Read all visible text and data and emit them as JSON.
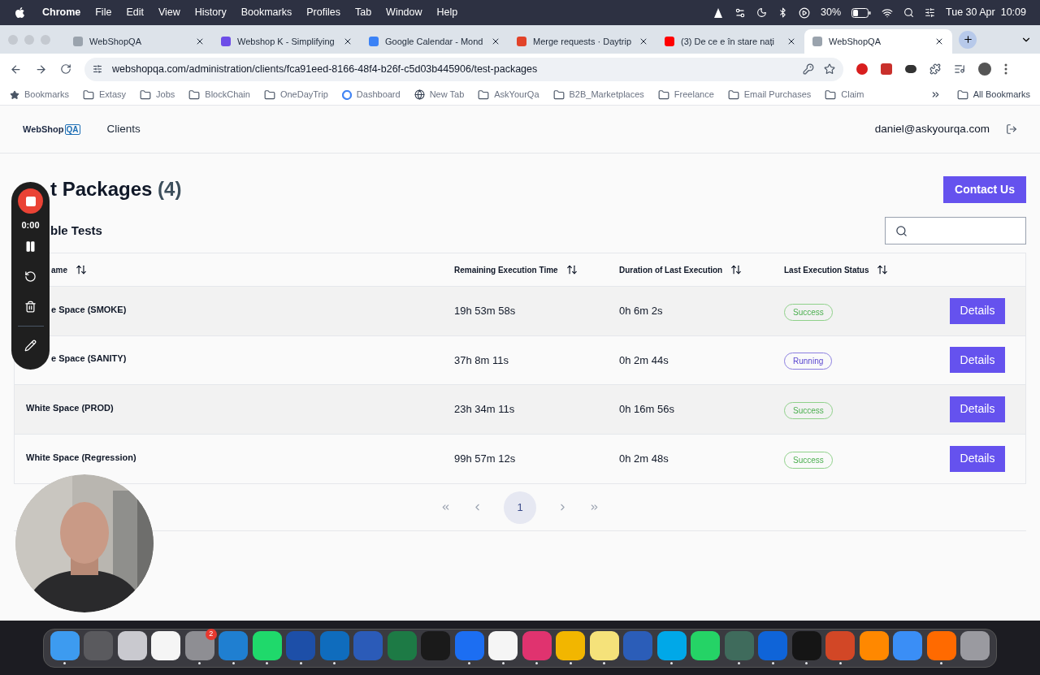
{
  "menu_bar": {
    "app": "Chrome",
    "items": [
      "File",
      "Edit",
      "View",
      "History",
      "Bookmarks",
      "Profiles",
      "Tab",
      "Window",
      "Help"
    ],
    "battery": "30%",
    "date": "Tue 30 Apr",
    "time": "10:09"
  },
  "tabs": [
    {
      "title": "WebShopQA",
      "selected": false,
      "color": "#9aa3ad"
    },
    {
      "title": "Webshop K - Simplifying",
      "selected": false,
      "color": "#6d4de8"
    },
    {
      "title": "Google Calendar - Mond",
      "selected": false,
      "color": "#3b82f6"
    },
    {
      "title": "Merge requests · Daytrip",
      "selected": false,
      "color": "#e24329"
    },
    {
      "title": "(3) De ce e în stare nați",
      "selected": false,
      "color": "#ff0000"
    },
    {
      "title": "WebShopQA",
      "selected": true,
      "color": "#9aa3ad"
    }
  ],
  "address": {
    "url": "webshopqa.com/administration/clients/fca91eed-8166-48f4-b26f-c5d03b445906/test-packages"
  },
  "bookmarks": [
    {
      "label": "Bookmarks",
      "kind": "star"
    },
    {
      "label": "Extasy",
      "kind": "folder"
    },
    {
      "label": "Jobs",
      "kind": "folder"
    },
    {
      "label": "BlockChain",
      "kind": "folder"
    },
    {
      "label": "OneDayTrip",
      "kind": "folder"
    },
    {
      "label": "Dashboard",
      "kind": "google"
    },
    {
      "label": "New Tab",
      "kind": "globe"
    },
    {
      "label": "AskYourQa",
      "kind": "folder"
    },
    {
      "label": "B2B_Marketplaces",
      "kind": "folder"
    },
    {
      "label": "Freelance",
      "kind": "folder"
    },
    {
      "label": "Email Purchases",
      "kind": "folder"
    },
    {
      "label": "Claim",
      "kind": "folder"
    }
  ],
  "all_bookmarks": "All Bookmarks",
  "header": {
    "logo": "WebShop",
    "logo_mark": "QA",
    "nav": "Clients",
    "user": "daniel@askyourqa.com"
  },
  "title": "t Packages",
  "count": "(4)",
  "contact_button": "Contact Us",
  "subtitle": "ble Tests",
  "table": {
    "columns": [
      "ame",
      "Remaining Execution Time",
      "Duration of Last Execution",
      "Last Execution Status"
    ],
    "rows": [
      {
        "name": "e Space (SMOKE)",
        "remaining": "19h 53m 58s",
        "duration": "0h 6m 2s",
        "status": {
          "label": "Success",
          "kind": "success"
        },
        "action": "Details"
      },
      {
        "name": "e Space (SANITY)",
        "remaining": "37h 8m 11s",
        "duration": "0h 2m 44s",
        "status": {
          "label": "Running",
          "kind": "running"
        },
        "action": "Details"
      },
      {
        "name": "White Space (PROD)",
        "remaining": "23h 34m 11s",
        "duration": "0h 16m 56s",
        "status": {
          "label": "Success",
          "kind": "success"
        },
        "action": "Details"
      },
      {
        "name": "White Space (Regression)",
        "remaining": "99h 57m 12s",
        "duration": "0h 2m 48s",
        "status": {
          "label": "Success",
          "kind": "success"
        },
        "action": "Details"
      }
    ]
  },
  "pagination": {
    "pages": [
      {
        "label": "1",
        "selected": true
      }
    ]
  },
  "recorder": {
    "timer": "0:00"
  },
  "dock": [
    {
      "color": "#3d9bf0",
      "running": true
    },
    {
      "color": "#5a5a5e",
      "running": false
    },
    {
      "color": "#c9c9cf",
      "running": false
    },
    {
      "color": "#f5f5f5",
      "running": false
    },
    {
      "color": "#8e8e93",
      "running": true,
      "badge": "2"
    },
    {
      "color": "#1f7fd1",
      "running": true
    },
    {
      "color": "#1fd96b",
      "running": true
    },
    {
      "color": "#1d4fa8",
      "running": true
    },
    {
      "color": "#0f6cbd",
      "running": true
    },
    {
      "color": "#2b5bb8",
      "running": false
    },
    {
      "color": "#1d7a45",
      "running": false
    },
    {
      "color": "#1a1a1a",
      "running": false
    },
    {
      "color": "#1c6ef2",
      "running": true
    },
    {
      "color": "#f5f5f5",
      "running": true
    },
    {
      "color": "#e0336f",
      "running": true
    },
    {
      "color": "#f2b600",
      "running": true
    },
    {
      "color": "#f5e27a",
      "running": true
    },
    {
      "color": "#2b5db8",
      "running": false
    },
    {
      "color": "#00a8e8",
      "running": true
    },
    {
      "color": "#25d366",
      "running": false
    },
    {
      "color": "#3f6b5c",
      "running": true
    },
    {
      "color": "#0f64d8",
      "running": true
    },
    {
      "color": "#151515",
      "running": true
    },
    {
      "color": "#d24726",
      "running": true
    },
    {
      "color": "#ff8800",
      "running": false
    },
    {
      "color": "#3a8ef6",
      "running": false
    },
    {
      "color": "#ff6a00",
      "running": true
    },
    {
      "color": "#9a9aa0",
      "running": false
    }
  ]
}
